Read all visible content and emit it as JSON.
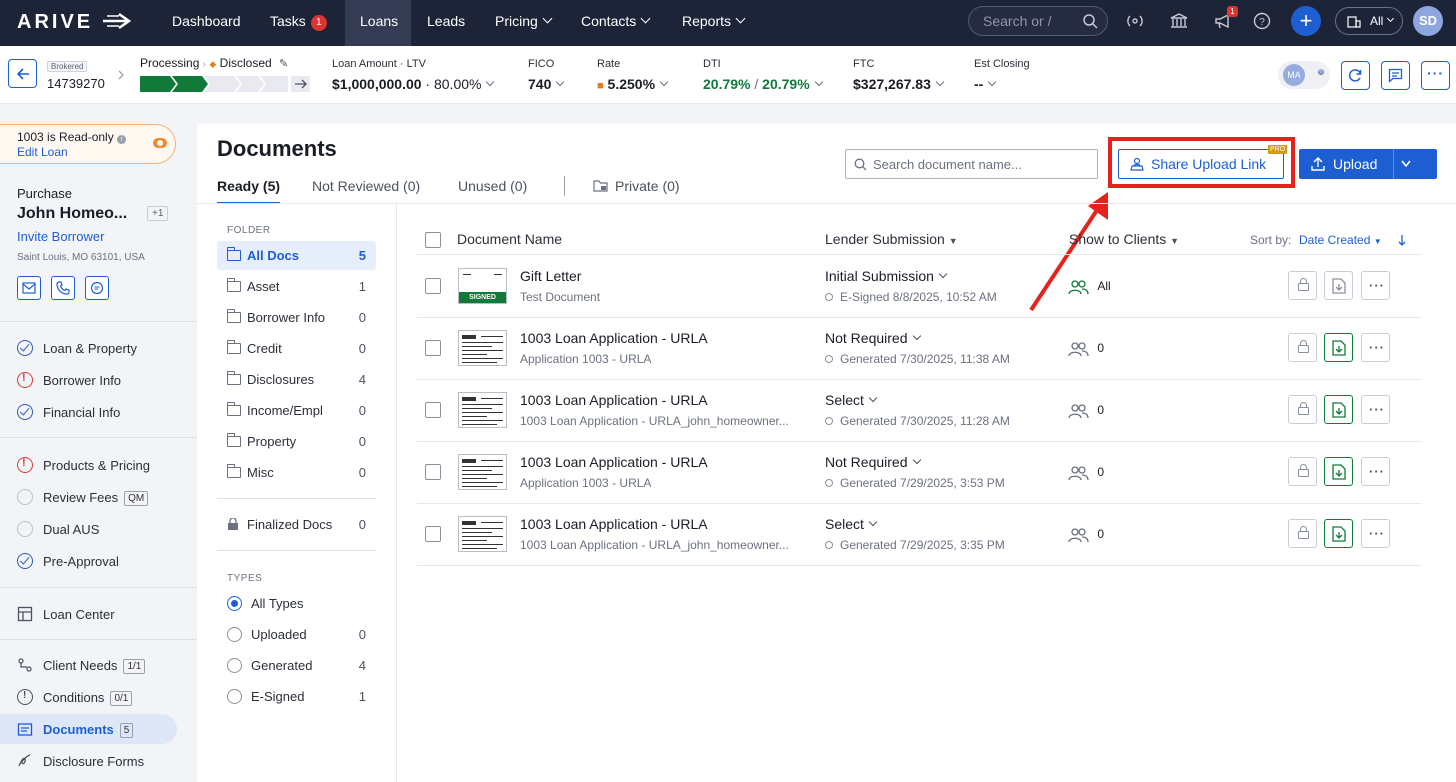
{
  "topnav": {
    "logo": "ARIVE",
    "items": [
      {
        "label": "Dashboard"
      },
      {
        "label": "Tasks",
        "badge": "1"
      },
      {
        "label": "Loans"
      },
      {
        "label": "Leads"
      },
      {
        "label": "Pricing"
      },
      {
        "label": "Contacts"
      },
      {
        "label": "Reports"
      }
    ],
    "search_placeholder": "Search or /",
    "notification_badge": "1",
    "company_select": "All",
    "avatar": "SD"
  },
  "loanbar": {
    "channel": "Brokered",
    "loan_id": "14739270",
    "status_from": "Processing",
    "status_to": "Disclosed",
    "loan_amount_label": "Loan Amount · LTV",
    "loan_amount": "$1,000,000.00",
    "ltv": "80.00%",
    "fico_label": "FICO",
    "fico": "740",
    "rate_label": "Rate",
    "rate": "5.250%",
    "dti_label": "DTI",
    "dti_front": "20.79%",
    "dti_sep": "/",
    "dti_back": "20.79%",
    "ftc_label": "FTC",
    "ftc": "$327,267.83",
    "closing_label": "Est Closing",
    "closing": "--",
    "assignee": "MA"
  },
  "sidebar": {
    "readonly_title": "1003 is Read-only",
    "edit_loan": "Edit Loan",
    "loan_purpose": "Purchase",
    "borrower_name": "John Homeo...",
    "borrower_extra": "+1",
    "invite": "Invite Borrower",
    "address": "Saint Louis, MO 63101, USA",
    "items": [
      {
        "label": "Loan & Property",
        "status": "ok"
      },
      {
        "label": "Borrower Info",
        "status": "error"
      },
      {
        "label": "Financial Info",
        "status": "ok"
      },
      {
        "label": "Products & Pricing",
        "status": "error"
      },
      {
        "label": "Review Fees",
        "status": "empty",
        "badge": "QM"
      },
      {
        "label": "Dual AUS",
        "status": "empty"
      },
      {
        "label": "Pre-Approval",
        "status": "ok"
      },
      {
        "label": "Loan Center"
      },
      {
        "label": "Client Needs",
        "badge": "1/1"
      },
      {
        "label": "Conditions",
        "badge": "0/1"
      },
      {
        "label": "Documents",
        "badge": "5"
      },
      {
        "label": "Disclosure Forms"
      }
    ]
  },
  "documents": {
    "title": "Documents",
    "tabs": [
      {
        "label": "Ready (5)"
      },
      {
        "label": "Not Reviewed (0)"
      },
      {
        "label": "Unused (0)"
      },
      {
        "label": "Private (0)"
      }
    ],
    "search_placeholder": "Search document name...",
    "share_button": "Share Upload Link",
    "pro_badge": "PRO",
    "upload_button": "Upload",
    "folder_header": "FOLDER",
    "folders": [
      {
        "name": "All Docs",
        "count": "5"
      },
      {
        "name": "Asset",
        "count": "1"
      },
      {
        "name": "Borrower Info",
        "count": "0"
      },
      {
        "name": "Credit",
        "count": "0"
      },
      {
        "name": "Disclosures",
        "count": "4"
      },
      {
        "name": "Income/Empl",
        "count": "0"
      },
      {
        "name": "Property",
        "count": "0"
      },
      {
        "name": "Misc",
        "count": "0"
      }
    ],
    "finalized": {
      "name": "Finalized Docs",
      "count": "0"
    },
    "types_header": "TYPES",
    "types": [
      {
        "name": "All Types",
        "count": ""
      },
      {
        "name": "Uploaded",
        "count": "0"
      },
      {
        "name": "Generated",
        "count": "4"
      },
      {
        "name": "E-Signed",
        "count": "1"
      }
    ],
    "columns": {
      "name": "Document Name",
      "lender": "Lender Submission",
      "clients": "Show to Clients",
      "sort_label": "Sort by:",
      "sort_value": "Date Created"
    },
    "rows": [
      {
        "name": "Gift Letter",
        "sub": "Test Document",
        "submission": "Initial Submission",
        "generated": "E-Signed 8/8/2025, 10:52 AM",
        "clients": "All",
        "signed": "SIGNED"
      },
      {
        "name": "1003 Loan Application - URLA",
        "sub": "Application 1003 - URLA",
        "submission": "Not Required",
        "generated": "Generated 7/30/2025, 11:38 AM",
        "clients": "0"
      },
      {
        "name": "1003 Loan Application - URLA",
        "sub": "1003 Loan Application - URLA_john_homeowner...",
        "submission": "Select",
        "generated": "Generated 7/30/2025, 11:28 AM",
        "clients": "0"
      },
      {
        "name": "1003 Loan Application - URLA",
        "sub": "Application 1003 - URLA",
        "submission": "Not Required",
        "generated": "Generated 7/29/2025, 3:53 PM",
        "clients": "0"
      },
      {
        "name": "1003 Loan Application - URLA",
        "sub": "1003 Loan Application - URLA_john_homeowner...",
        "submission": "Select",
        "generated": "Generated 7/29/2025, 3:35 PM",
        "clients": "0"
      }
    ]
  },
  "colors": {
    "accent": "#1d5fd3",
    "nav": "#1e2438",
    "highlight": "#e5221c",
    "signed": "#117a3a"
  }
}
